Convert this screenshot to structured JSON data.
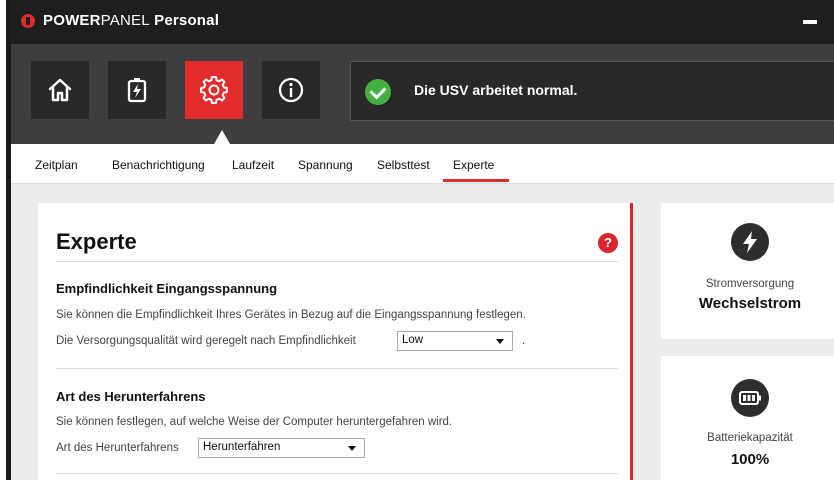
{
  "app": {
    "brand_part1": "POWER",
    "brand_part2": "PANEL",
    "brand_part3": " Personal",
    "accent_color": "#e32b2b",
    "logo_icon": "power-logo-icon"
  },
  "nav": {
    "buttons": [
      {
        "icon": "home-icon",
        "active": false
      },
      {
        "icon": "battery-bolt-icon",
        "active": false
      },
      {
        "icon": "gear-icon",
        "active": true
      },
      {
        "icon": "info-icon",
        "active": false
      }
    ]
  },
  "status": {
    "icon": "checkmark-icon",
    "text": "Die USV arbeitet normal.",
    "color": "#43b041"
  },
  "tabs": [
    {
      "label": "Zeitplan"
    },
    {
      "label": "Benachrichtigung"
    },
    {
      "label": "Laufzeit"
    },
    {
      "label": "Spannung"
    },
    {
      "label": "Selbsttest"
    },
    {
      "label": "Experte",
      "selected": true
    }
  ],
  "panel": {
    "title": "Experte",
    "help_icon": "?",
    "sections": [
      {
        "title": "Empfindlichkeit Eingangsspannung",
        "description": "Sie können die Empfindlichkeit Ihres Gerätes in Bezug auf die Eingangsspannung festlegen.",
        "field_label": "Die Versorgungsqualität wird geregelt nach Empfindlichkeit",
        "select_value": "Low",
        "suffix": "."
      },
      {
        "title": "Art des Herunterfahrens",
        "description": "Sie können festlegen, auf welche Weise der Computer heruntergefahren wird.",
        "field_label": "Art des Herunterfahrens",
        "select_value": "Herunterfahren"
      }
    ]
  },
  "cards": [
    {
      "icon": "lightning-icon",
      "label": "Stromversorgung",
      "value": "Wechselstrom"
    },
    {
      "icon": "battery-icon",
      "label": "Batteriekapazität",
      "value": "100%"
    }
  ]
}
